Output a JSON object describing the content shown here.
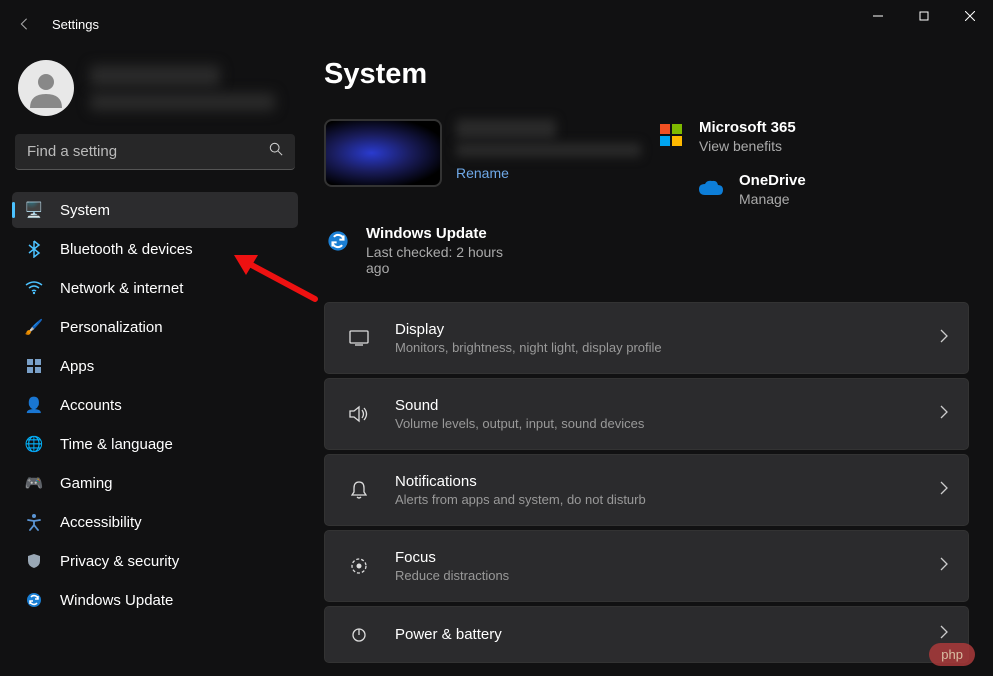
{
  "window": {
    "title": "Settings"
  },
  "search": {
    "placeholder": "Find a setting"
  },
  "sidebar": {
    "items": [
      {
        "label": "System",
        "icon": "monitor-icon",
        "color": "#4cc2ff",
        "active": true
      },
      {
        "label": "Bluetooth & devices",
        "icon": "bluetooth-icon",
        "color": "#4cc2ff",
        "active": false
      },
      {
        "label": "Network & internet",
        "icon": "wifi-icon",
        "color": "#4cc2ff",
        "active": false
      },
      {
        "label": "Personalization",
        "icon": "brush-icon",
        "color": "#d98c5a",
        "active": false
      },
      {
        "label": "Apps",
        "icon": "apps-icon",
        "color": "#7aa0c8",
        "active": false
      },
      {
        "label": "Accounts",
        "icon": "person-icon",
        "color": "#6a8fb5",
        "active": false
      },
      {
        "label": "Time & language",
        "icon": "clock-globe-icon",
        "color": "#5fb0d8",
        "active": false
      },
      {
        "label": "Gaming",
        "icon": "gamepad-icon",
        "color": "#b8c8d8",
        "active": false
      },
      {
        "label": "Accessibility",
        "icon": "accessibility-icon",
        "color": "#5b95d5",
        "active": false
      },
      {
        "label": "Privacy & security",
        "icon": "shield-icon",
        "color": "#9aa8b5",
        "active": false
      },
      {
        "label": "Windows Update",
        "icon": "sync-icon",
        "color": "#4cc2ff",
        "active": false
      }
    ]
  },
  "main": {
    "title": "System",
    "device": {
      "rename_label": "Rename"
    },
    "cards": {
      "ms365": {
        "title": "Microsoft 365",
        "sub": "View benefits"
      },
      "onedrive": {
        "title": "OneDrive",
        "sub": "Manage"
      },
      "update": {
        "title": "Windows Update",
        "sub": "Last checked: 2 hours ago"
      }
    },
    "settings": [
      {
        "title": "Display",
        "sub": "Monitors, brightness, night light, display profile",
        "icon": "display-icon"
      },
      {
        "title": "Sound",
        "sub": "Volume levels, output, input, sound devices",
        "icon": "speaker-icon"
      },
      {
        "title": "Notifications",
        "sub": "Alerts from apps and system, do not disturb",
        "icon": "bell-icon"
      },
      {
        "title": "Focus",
        "sub": "Reduce distractions",
        "icon": "target-icon"
      },
      {
        "title": "Power & battery",
        "sub": "",
        "icon": "power-icon"
      }
    ]
  },
  "badge": {
    "text": "php"
  }
}
